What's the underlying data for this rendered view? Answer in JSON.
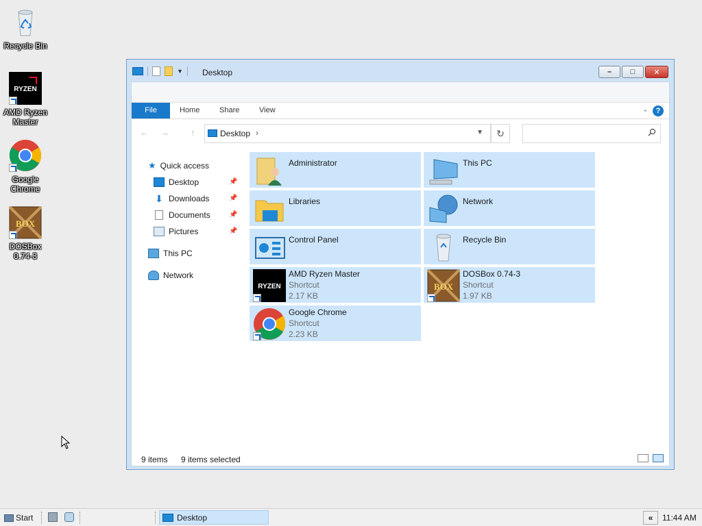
{
  "desktop": {
    "icons": [
      {
        "name": "recycle-bin",
        "label": "Recycle Bin"
      },
      {
        "name": "amd-ryzen-master",
        "label": "AMD Ryzen Master",
        "logo_text": "RYZEN"
      },
      {
        "name": "google-chrome",
        "label": "Google Chrome"
      },
      {
        "name": "dosbox",
        "label": "DOSBox 0.74-3",
        "logo_text": "BOX"
      }
    ]
  },
  "window": {
    "title": "Desktop",
    "ribbon": {
      "file_tab": "File",
      "tabs": [
        "Home",
        "Share",
        "View"
      ],
      "help": "?"
    },
    "address": {
      "crumb": "Desktop",
      "separator": "›",
      "refresh": "↻",
      "search_placeholder": ""
    },
    "tree": {
      "quick_access": "Quick access",
      "quick_items": [
        "Desktop",
        "Downloads",
        "Documents",
        "Pictures"
      ],
      "this_pc": "This PC",
      "network": "Network"
    },
    "items": [
      {
        "name": "Administrator",
        "type": "",
        "size": "",
        "icon": "user-folder-icon"
      },
      {
        "name": "This PC",
        "type": "",
        "size": "",
        "icon": "computer-icon"
      },
      {
        "name": "Libraries",
        "type": "",
        "size": "",
        "icon": "libraries-icon"
      },
      {
        "name": "Network",
        "type": "",
        "size": "",
        "icon": "network-icon"
      },
      {
        "name": "Control Panel",
        "type": "",
        "size": "",
        "icon": "control-panel-icon"
      },
      {
        "name": "Recycle Bin",
        "type": "",
        "size": "",
        "icon": "recycle-bin-icon"
      },
      {
        "name": "AMD Ryzen Master",
        "type": "Shortcut",
        "size": "2.17 KB",
        "icon": "ryzen-icon"
      },
      {
        "name": "DOSBox 0.74-3",
        "type": "Shortcut",
        "size": "1.97 KB",
        "icon": "dosbox-icon"
      },
      {
        "name": "Google Chrome",
        "type": "Shortcut",
        "size": "2.23 KB",
        "icon": "chrome-icon"
      }
    ],
    "status": {
      "count": "9 items",
      "selected": "9 items selected"
    }
  },
  "taskbar": {
    "start_label": "Start",
    "task_label": "Desktop",
    "tray_chevron": "«",
    "clock": "11:44 AM"
  },
  "colors": {
    "selection": "#cce5fb",
    "accent": "#1979ca",
    "frame": "#cfe2f5"
  }
}
